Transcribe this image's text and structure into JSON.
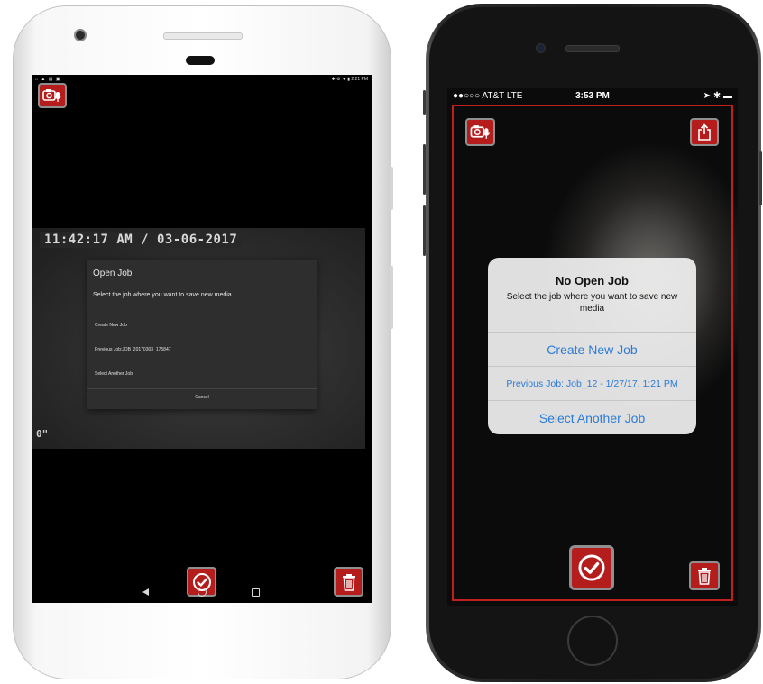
{
  "android": {
    "status_left": "□ ▲ ▤ ▣",
    "status_right": "✱ ⚙ ▼ ▮ 2:21 PM",
    "timestamp": "11:42:17 AM / 03-06-2017",
    "depth": "0\"",
    "dialog": {
      "title": "Open Job",
      "message": "Select the job where you want to save new media",
      "options": [
        "Create New Job",
        "Previous Job:JOB_20170303_175847",
        "Select Another Job"
      ],
      "cancel": "Cancel"
    }
  },
  "ios": {
    "status": {
      "carrier": "●●○○○ AT&T  LTE",
      "time": "3:53 PM",
      "right": "➤ ✱ ▬"
    },
    "alert": {
      "title": "No Open Job",
      "message": "Select the job where you want to save new media",
      "options": [
        "Create New Job",
        "Previous Job: Job_12 - 1/27/17, 1:21 PM",
        "Select Another Job"
      ]
    }
  },
  "colors": {
    "accent_red": "#b51d1d",
    "frame_red": "#c0201b",
    "ios_link_blue": "#2a7bd8",
    "android_divider": "#58a6c8"
  },
  "icons": [
    "camera-mic-icon",
    "checkmark-icon",
    "trash-icon",
    "share-icon",
    "back-icon",
    "home-icon",
    "recents-icon"
  ]
}
